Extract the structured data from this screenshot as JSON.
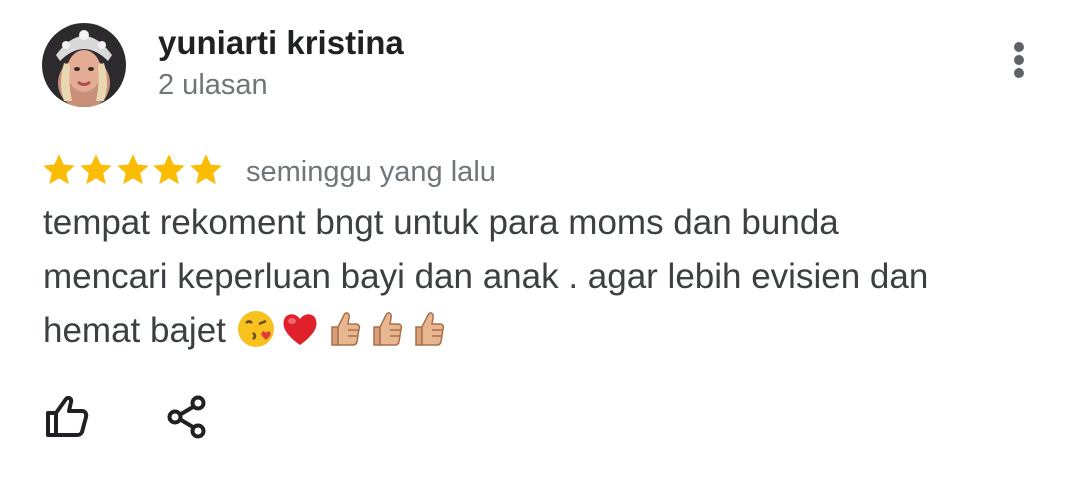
{
  "reviewer": {
    "name": "yuniarti kristina",
    "review_count": "2 ulasan",
    "avatar_icon": "profile-photo"
  },
  "review": {
    "rating": 5,
    "rating_max": 5,
    "star_color": "#fbbc04",
    "time": "seminggu yang lalu",
    "text_lines": [
      "tempat rekoment bngt untuk para moms dan bunda",
      "mencari keperluan bayi dan anak . agar lebih evisien dan",
      "hemat bajet"
    ],
    "emojis": [
      "face-blowing-kiss",
      "red-heart",
      "thumbs-up",
      "thumbs-up",
      "thumbs-up"
    ]
  },
  "actions": {
    "like_icon": "thumbs-up-outline-icon",
    "share_icon": "share-icon",
    "more_icon": "more-vertical-icon"
  }
}
